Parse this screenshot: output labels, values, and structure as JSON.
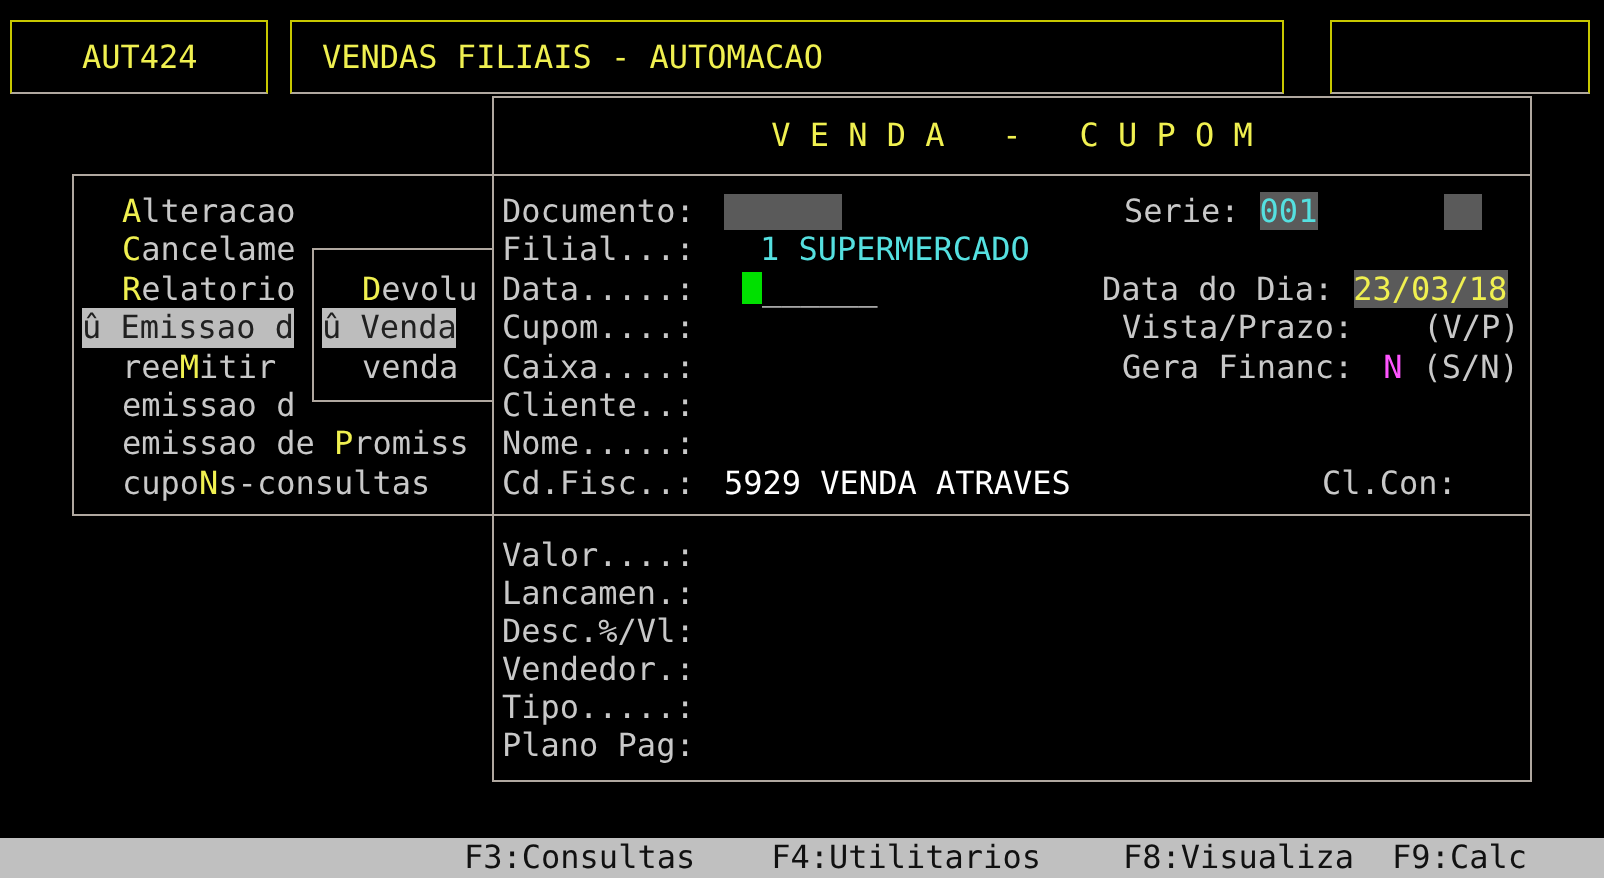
{
  "header": {
    "program_code": "AUT424",
    "title": "VENDAS FILIAIS - AUTOMACAO"
  },
  "menu": {
    "items": [
      {
        "key": "A",
        "after": "lteracao",
        "selected": false
      },
      {
        "key": "C",
        "after": "ancelame",
        "selected": false
      },
      {
        "key": "R",
        "after": "elatorio",
        "selected": false
      },
      {
        "text": "û Emissao d",
        "selected": true
      },
      {
        "before": "ree",
        "key": "M",
        "after": "itir",
        "selected": false
      },
      {
        "text": "emissao d",
        "selected": false
      },
      {
        "before": "emissao de ",
        "key": "P",
        "after": "romiss",
        "selected": false
      },
      {
        "before": "cupo",
        "key": "N",
        "after": "s-consultas",
        "selected": false
      }
    ]
  },
  "submenu": {
    "items": [
      {
        "key": "D",
        "after": "evolu",
        "selected": false
      },
      {
        "text": "û Venda",
        "selected": true
      },
      {
        "text": "venda",
        "selected": false
      }
    ]
  },
  "form": {
    "title": "V E N D A   -   C U P O M",
    "documento": {
      "label": "Documento:"
    },
    "serie": {
      "label": "Serie:",
      "value": "001"
    },
    "filial": {
      "label": "Filial...:",
      "value": "1 SUPERMERCADO"
    },
    "data": {
      "label": "Data.....:",
      "value": "______"
    },
    "data_do_dia": {
      "label": "Data do Dia:",
      "value": "23/03/18"
    },
    "cupom": {
      "label": "Cupom....:"
    },
    "vista_prazo": {
      "label": "Vista/Prazo:",
      "hint": "(V/P)"
    },
    "caixa": {
      "label": "Caixa....:"
    },
    "gera_financ": {
      "label": "Gera Financ:",
      "value": "N",
      "hint": "(S/N)"
    },
    "cliente": {
      "label": "Cliente..:"
    },
    "nome": {
      "label": "Nome.....:"
    },
    "cd_fisc": {
      "label": "Cd.Fisc..:",
      "value": "5929 VENDA ATRAVES"
    },
    "cl_con": {
      "label": "Cl.Con:"
    },
    "lower_fields": [
      {
        "label": "Valor....:"
      },
      {
        "label": "Lancamen.:"
      },
      {
        "label": "Desc.%/Vl:"
      },
      {
        "label": "Vendedor.:"
      },
      {
        "label": "Tipo.....:"
      },
      {
        "label": "Plano Pag:"
      }
    ]
  },
  "function_keys": [
    "F3:Consultas",
    "F4:Utilitarios",
    "F8:Visualiza",
    "F9:Calc"
  ]
}
